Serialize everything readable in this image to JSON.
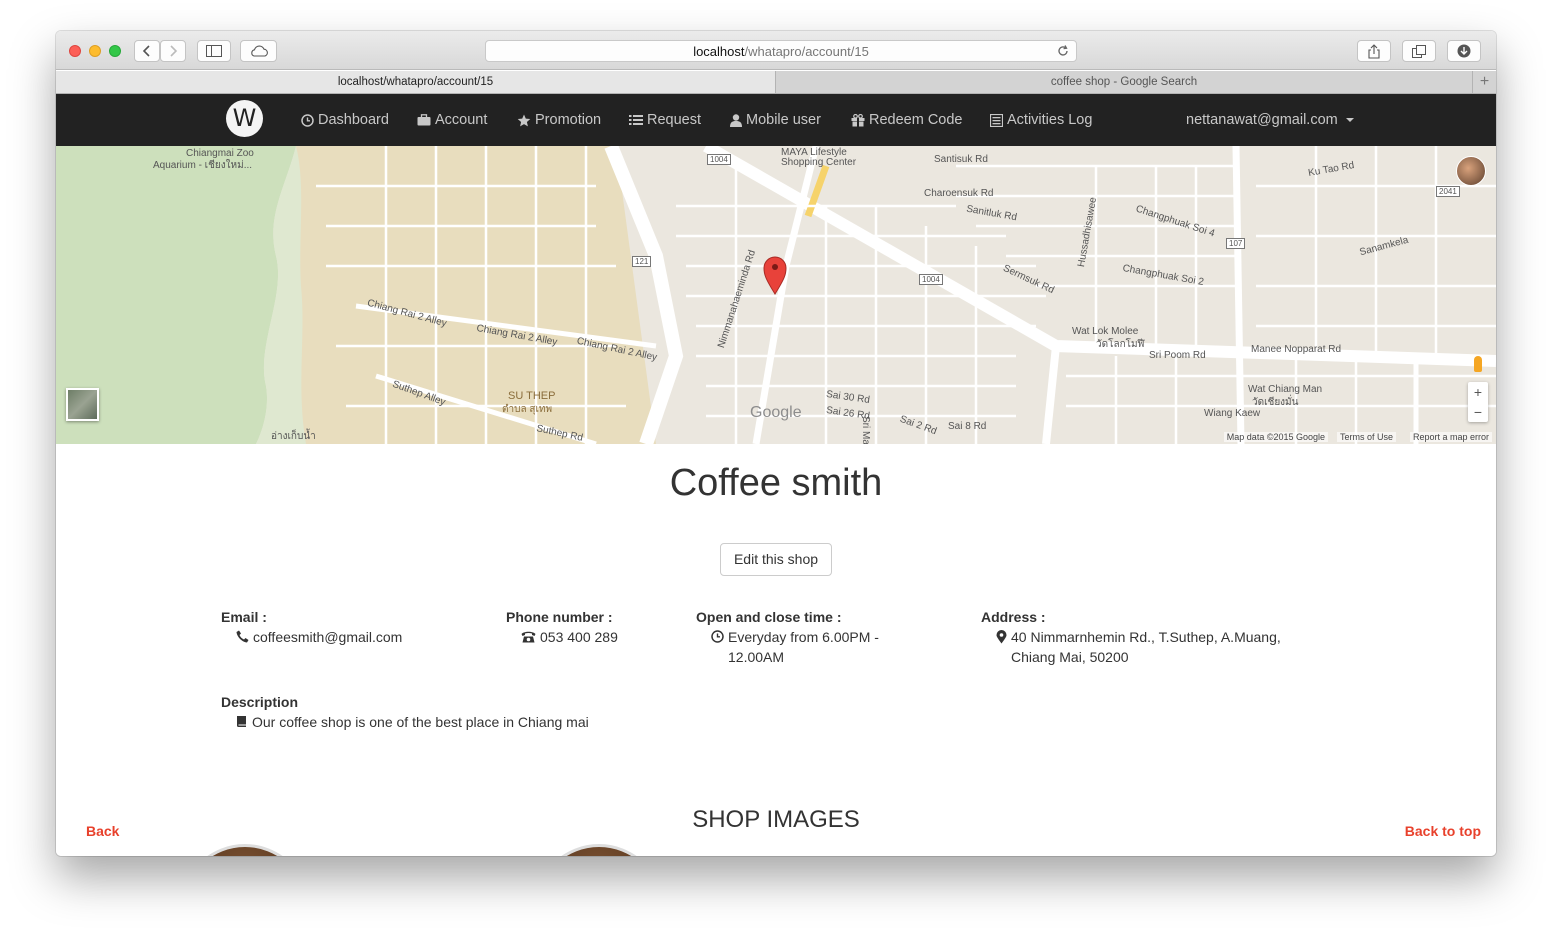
{
  "browser": {
    "url_host": "localhost",
    "url_path": "/whatapro/account/15",
    "tabs": [
      {
        "label": "localhost/whatapro/account/15",
        "active": true
      },
      {
        "label": "coffee shop - Google Search",
        "active": false
      }
    ],
    "new_tab_label": "+"
  },
  "navbar": {
    "brand_letter": "W",
    "items": [
      {
        "label": "Dashboard",
        "icon": "clock-icon"
      },
      {
        "label": "Account",
        "icon": "briefcase-icon"
      },
      {
        "label": "Promotion",
        "icon": "star-icon"
      },
      {
        "label": "Request",
        "icon": "list-icon"
      },
      {
        "label": "Mobile user",
        "icon": "user-icon"
      },
      {
        "label": "Redeem Code",
        "icon": "gift-icon"
      },
      {
        "label": "Activities Log",
        "icon": "list-alt-icon"
      }
    ],
    "user_email": "nettanawat@gmail.com"
  },
  "map": {
    "labels": {
      "zoo": "Chiangmai Zoo",
      "aquarium": "Aquarium - เชียงใหม่...",
      "maya": "MAYA Lifestyle",
      "maya2": "Shopping Center",
      "santisuk": "Santisuk Rd",
      "charoensuk": "Charoensuk Rd",
      "sanitluk": "Sanitluk Rd",
      "changphuak4": "Changphuak Soi 4",
      "changphuak2": "Changphuak Soi 2",
      "sermsuk": "Sermsuk Rd",
      "chiangrai_a": "Chiang Rai 2 Alley",
      "chiangrai_b": "Chiang Rai 2 Alley",
      "chiangrai_c": "Chiang Rai 2 Alley",
      "suthep_alley": "Suthep Alley",
      "suthep_rd": "Suthep Rd",
      "su_thep": "SU THEP",
      "su_thep_th": "ตำบล สุเทพ",
      "nimman": "Nimmanahaeminda Rd",
      "wat_lok": "Wat Lok Molee",
      "wat_lok_th": "วัดโลกโมฬี",
      "sri_poom": "Sri Poom Rd",
      "manee": "Manee Nopparat Rd",
      "wat_chiang_man": "Wat Chiang Man",
      "wat_chiang_man_th": "วัดเชียงมั่น",
      "wiang_kaew": "Wiang Kaew",
      "sai30": "Sai 30 Rd",
      "sai26": "Sai 26 Rd",
      "sai8": "Sai 8 Rd",
      "sai2": "Sai 2 Rd",
      "sri_mangkalajarn": "Sri Mangkalajarn",
      "google": "Google",
      "ku_tao": "Ku Tao Rd",
      "sanamkela": "Sanamkela",
      "hussadhisawee": "Hussadhisawee",
      "ang_kaew": "อ่างเก็บน้ำ",
      "road_1004a": "1004",
      "road_1004b": "1004",
      "road_121": "121",
      "road_107": "107",
      "road_2041": "2041"
    },
    "footer": {
      "data": "Map data ©2015 Google",
      "terms": "Terms of Use",
      "report": "Report a map error"
    },
    "zoom_in": "+",
    "zoom_out": "−"
  },
  "shop": {
    "name": "Coffee smith",
    "edit_button": "Edit this shop",
    "email_label": "Email :",
    "email": "coffeesmith@gmail.com",
    "phone_label": "Phone number :",
    "phone": "053 400 289",
    "hours_label": "Open and close time :",
    "hours": "Everyday from 6.00PM - 12.00AM",
    "address_label": "Address :",
    "address": "40 Nimmarnhemin Rd., T.Suthep, A.Muang, Chiang Mai, 50200",
    "description_label": "Description",
    "description": "Our coffee shop is one of the best place in Chiang mai",
    "images_title": "SHOP IMAGES",
    "back": "Back",
    "back_to_top": "Back to top"
  },
  "colors": {
    "navbar_bg": "#222222",
    "accent_red": "#e8412c",
    "map_pin": "#e8423a"
  }
}
